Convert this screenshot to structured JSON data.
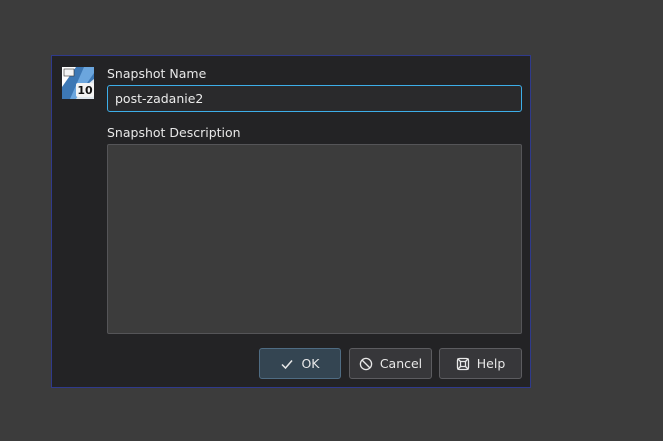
{
  "dialog": {
    "icon": "application-10-icon",
    "name_label": "Snapshot Name",
    "name_value": "post-zadanie2",
    "description_label": "Snapshot Description",
    "description_value": ""
  },
  "buttons": {
    "ok": {
      "label": "OK",
      "icon": "checkmark-icon"
    },
    "cancel": {
      "label": "Cancel",
      "icon": "cancel-icon"
    },
    "help": {
      "label": "Help",
      "icon": "lifebuoy-icon"
    }
  },
  "colors": {
    "background": "#3c3c3c",
    "dialog": "#232325",
    "dialog_border": "#2f3a8c",
    "focus_accent": "#3daee9"
  }
}
